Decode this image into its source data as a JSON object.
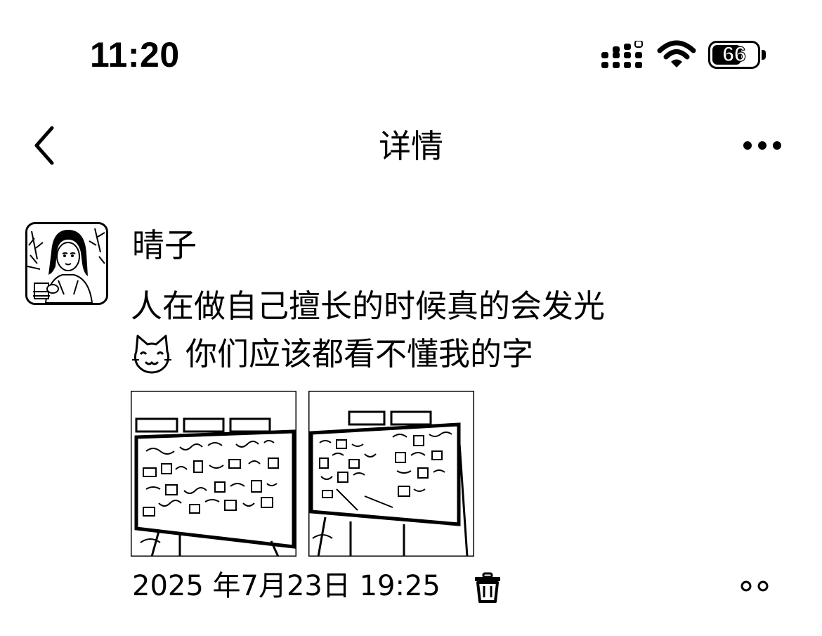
{
  "status_bar": {
    "time": "11:20",
    "battery_level": "66",
    "icons": [
      "signal-icon",
      "wifi-icon",
      "battery-icon"
    ]
  },
  "nav": {
    "title": "详情",
    "back_icon": "chevron-left-icon",
    "more_icon": "more-horizontal-icon"
  },
  "post": {
    "author": "晴子",
    "text_line1": "人在做自己擅长的时候真的会发光",
    "emoji": "cat-face-icon",
    "text_line2": "你们应该都看不懂我的字",
    "photos": [
      {
        "name": "photo-1"
      },
      {
        "name": "photo-2"
      }
    ],
    "timestamp": "2025 年7月23日 19:25",
    "delete_icon": "trash-icon",
    "comment_icon": "two-dots-icon"
  }
}
